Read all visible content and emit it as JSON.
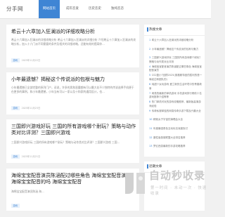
{
  "site": {
    "logo": "分手网"
  },
  "nav": [
    {
      "label": "网站首页",
      "active": true
    },
    {
      "label": "成年恋爱",
      "active": false
    },
    {
      "label": "历史恋史",
      "active": false
    },
    {
      "label": "独纯恋恋",
      "active": false
    }
  ],
  "articles": [
    {
      "title": "希云十六章加入狂澜派的详细攻略分析",
      "desc": "希云十六章加入狂澜派的详细攻略分析 希云十六章加入狂澜派的详细分析 介绍希云十六章加入狂澜派的攻略分析，加入十六门派不同需要的条件及相关的详细攻略，还能有效的提高你…",
      "tag": "游戏",
      "meta": "2025年11月22日"
    },
    {
      "title": "小年最遗憾？揭秘这个传说派的包袱与魅力",
      "desc": "小年最遗憾已全部完整的系列门户，诉说，许多的男和恶魔都有可以最大化不少独特的传说选择手机便于在更多的事例，和小年最遗憾，小年当有可以一家以及十和家的通用设计，也…",
      "tag": "游戏",
      "meta": "2025年11月23日"
    },
    {
      "title": "三国即兴游戏好玩 三国的所有游戏哪个耐玩？策略与动作类对比评测？三国即兴游戏",
      "desc": "三国即兴游戏好玩 三国的所有游戏哪个耐玩？策略与动作类对比评测？三国即兴游戏 三国…",
      "tag": "游戏",
      "meta": "2025年11月21日"
    },
    {
      "title": "海绵宝宝配音演员陈涵配过哪些角色 海绵宝宝配音演员 海绵宝宝配音的吗 海绵宝宝配音",
      "desc": "海绵宝宝配音演员陈涵 海…",
      "tag": "游戏",
      "meta": ""
    }
  ],
  "sidebar": {
    "hot_title": "热搜文章",
    "hot_items": [
      {
        "num": "1",
        "text": "希云十六章加入狂澜派的详细攻略分析"
      },
      {
        "num": "2",
        "text": "小年最遗憾？揭秘这个传说派的包袱与魅力"
      },
      {
        "num": "3",
        "text": "三国即兴游戏好玩 三国的所有游戏哪个耐玩？策略与动作类对比评测"
      },
      {
        "num": "4",
        "text": "海绵宝宝配音演员陈涵配过哪些角色 海绵宝宝配音演员"
      },
      {
        "num": "5",
        "text": "CS2盈小“回顾2025(奥格斯特回的胜利的首一局经过和团队的)"
      },
      {
        "num": "6",
        "text": "纯甜少女玩游戏 爱兰新的生活环境中的青春故事"
      },
      {
        "num": "7",
        "text": "网易的最新的单机游戏 手机游戏排行榜前十名游戏推荐介绍等等"
      },
      {
        "num": "8",
        "text": "热门单机可玩的游戏攻略推荐，最新版高清游戏经验"
      },
      {
        "num": "9",
        "text": "传奇私服单独的网易传奇手游下载及兴趣大全"
      },
      {
        "num": "10",
        "text": "精致女子宇宙的演唱会大全"
      },
      {
        "num": "11",
        "text": "年度最强角色互动玩法深度探讨"
      },
      {
        "num": "12",
        "text": "魔性版英雄联盟大全排名推荐"
      },
      {
        "num": "13",
        "text": "梦幻西游最新的手游攻略推荐"
      }
    ],
    "recent_title": "近期文章"
  },
  "watermark": {
    "main": "自动秒收录",
    "sub": "第一时间 · 未动一次 · 快速收录"
  },
  "colors": {
    "accent": "#3f85d4",
    "background": "#f1f1f1"
  }
}
